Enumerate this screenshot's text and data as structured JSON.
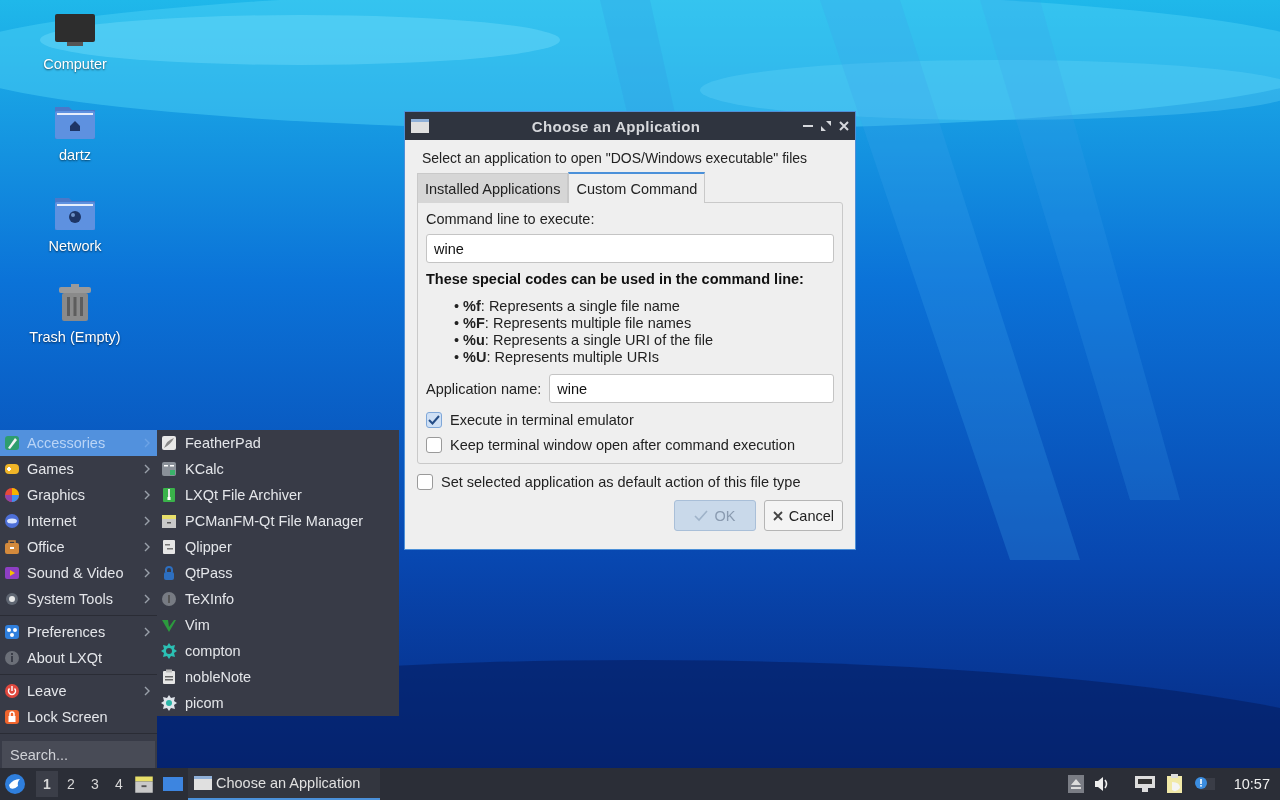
{
  "desktop_icons": [
    {
      "label": "Computer",
      "kind": "computer"
    },
    {
      "label": "dartz",
      "kind": "home"
    },
    {
      "label": "Network",
      "kind": "network"
    },
    {
      "label": "Trash (Empty)",
      "kind": "trash"
    }
  ],
  "start_menu": {
    "groups": [
      [
        {
          "label": "Accessories",
          "kind": "accessories",
          "submenu": true,
          "selected": true
        },
        {
          "label": "Games",
          "kind": "games",
          "submenu": true,
          "selected": false
        },
        {
          "label": "Graphics",
          "kind": "graphics",
          "submenu": true,
          "selected": false
        },
        {
          "label": "Internet",
          "kind": "internet",
          "submenu": true,
          "selected": false
        },
        {
          "label": "Office",
          "kind": "office",
          "submenu": true,
          "selected": false
        },
        {
          "label": "Sound & Video",
          "kind": "media",
          "submenu": true,
          "selected": false
        },
        {
          "label": "System Tools",
          "kind": "system",
          "submenu": true,
          "selected": false
        }
      ],
      [
        {
          "label": "Preferences",
          "kind": "preferences",
          "submenu": true,
          "selected": false
        },
        {
          "label": "About LXQt",
          "kind": "about",
          "submenu": false,
          "selected": false
        }
      ],
      [
        {
          "label": "Leave",
          "kind": "leave",
          "submenu": true,
          "selected": false
        },
        {
          "label": "Lock Screen",
          "kind": "lock",
          "submenu": false,
          "selected": false
        }
      ]
    ],
    "search": {
      "placeholder": "Search..."
    },
    "submenu": [
      {
        "label": "FeatherPad",
        "kind": "featherpad"
      },
      {
        "label": "KCalc",
        "kind": "kcalc"
      },
      {
        "label": "LXQt File Archiver",
        "kind": "archiver"
      },
      {
        "label": "PCManFM-Qt File Manager",
        "kind": "filemanager"
      },
      {
        "label": "Qlipper",
        "kind": "qlipper"
      },
      {
        "label": "QtPass",
        "kind": "qtpass"
      },
      {
        "label": "TeXInfo",
        "kind": "texinfo"
      },
      {
        "label": "Vim",
        "kind": "vim"
      },
      {
        "label": "compton",
        "kind": "compton"
      },
      {
        "label": "nobleNote",
        "kind": "noblenote"
      },
      {
        "label": "picom",
        "kind": "picom"
      }
    ]
  },
  "dialog": {
    "title": "Choose an Application",
    "prompt": "Select an application to open \"DOS/Windows executable\" files",
    "tabs": [
      {
        "label": "Installed Applications",
        "selected": false
      },
      {
        "label": "Custom Command",
        "selected": true
      }
    ],
    "command_label": "Command line to execute:",
    "command_value": "wine",
    "codes_heading": "These special codes can be used in the command line:",
    "codes": [
      "• **%f**: Represents a single file name",
      "• **%F**: Represents multiple file names",
      "• **%u**: Represents a single URI of the file",
      "• **%U**: Represents multiple URIs"
    ],
    "app_name_label": "Application name:",
    "app_name_value": "wine",
    "options": [
      {
        "label": "Execute in terminal emulator",
        "checked": true
      },
      {
        "label": "Keep terminal window open after command execution",
        "checked": false
      }
    ],
    "default_option": {
      "label": "Set selected application as default action of this file type",
      "checked": false
    },
    "buttons": [
      {
        "label": "OK",
        "kind": "ok",
        "disabled": true
      },
      {
        "label": "Cancel",
        "kind": "cancel",
        "disabled": false
      }
    ]
  },
  "taskbar": {
    "workspaces": [
      {
        "label": "1",
        "selected": true
      },
      {
        "label": "2",
        "selected": false
      },
      {
        "label": "3",
        "selected": false
      },
      {
        "label": "4",
        "selected": false
      }
    ],
    "task": {
      "title": "Choose an Application"
    },
    "clock": "10:57"
  }
}
